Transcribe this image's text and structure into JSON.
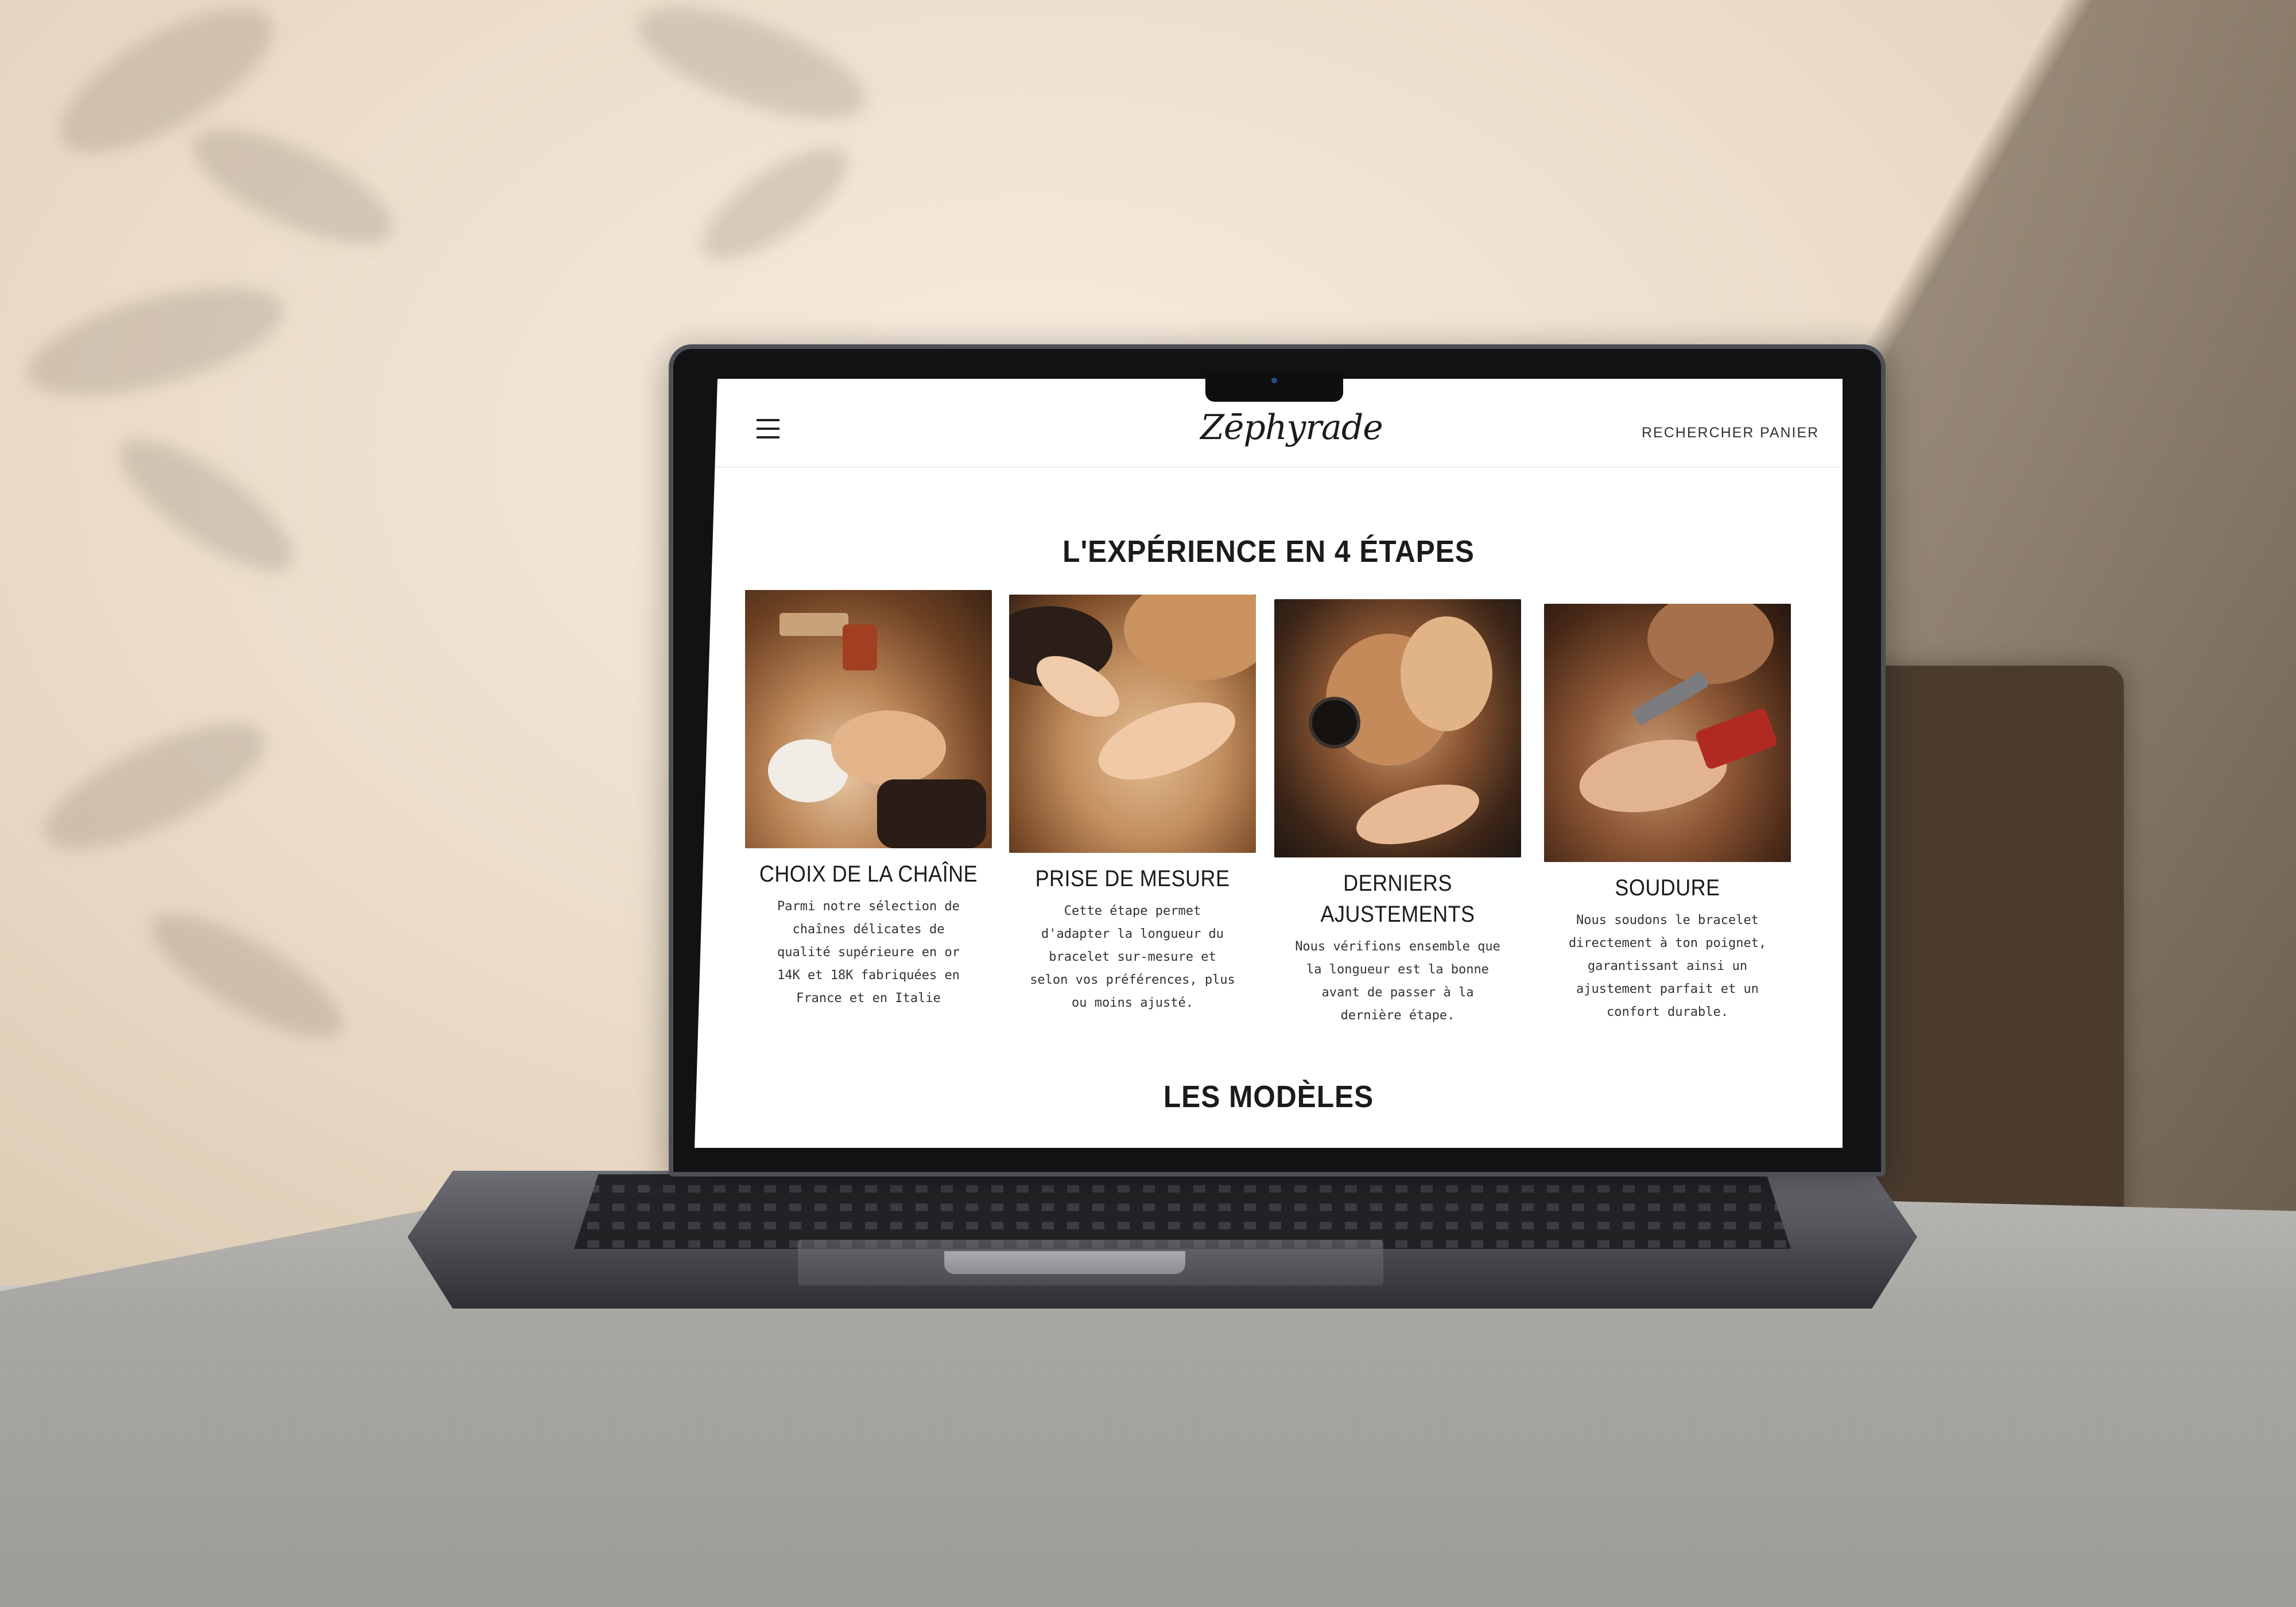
{
  "site": {
    "logo": "Zēphyrade",
    "nav": {
      "search": "RECHERCHER",
      "cart": "PANIER"
    }
  },
  "experience": {
    "title": "L'EXPÉRIENCE EN 4 ÉTAPES",
    "steps": [
      {
        "title": "CHOIX DE LA CHAÎNE",
        "text": "Parmi notre sélection de chaînes délicates de qualité supérieure en or 14K et 18K fabriquées en France et en Italie"
      },
      {
        "title": "PRISE DE MESURE",
        "text": "Cette étape permet d'adapter la longueur du bracelet sur-mesure et selon vos préférences, plus ou moins ajusté."
      },
      {
        "title": "DERNIERS AJUSTEMENTS",
        "text": "Nous vérifions ensemble que la longueur est la bonne avant de passer à la dernière étape."
      },
      {
        "title": "SOUDURE",
        "text": "Nous soudons le bracelet directement à ton poignet, garantissant ainsi un ajustement parfait et un confort durable."
      }
    ]
  },
  "models": {
    "title": "LES MODÈLES"
  },
  "icons": {
    "menu": "hamburger-menu-icon"
  }
}
